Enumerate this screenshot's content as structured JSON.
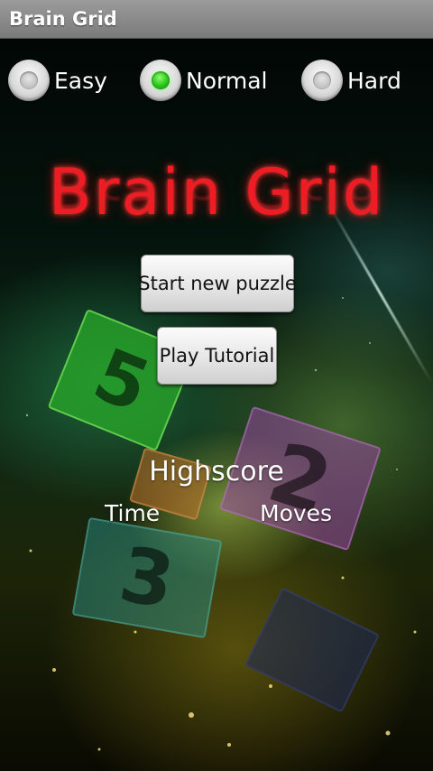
{
  "app": {
    "title": "Brain Grid"
  },
  "difficulty": {
    "options": [
      {
        "label": "Easy",
        "selected": false
      },
      {
        "label": "Normal",
        "selected": true
      },
      {
        "label": "Hard",
        "selected": false
      }
    ]
  },
  "logo": {
    "text": "Brain Grid"
  },
  "buttons": {
    "start_label": "Start new puzzle",
    "tutorial_label": "Play Tutorial"
  },
  "highscore": {
    "title": "Highscore",
    "time_label": "Time",
    "moves_label": "Moves"
  },
  "colors": {
    "accent_red": "#ee1d24",
    "radio_selected": "#27c21a",
    "titlebar": "#8a8a8a"
  }
}
